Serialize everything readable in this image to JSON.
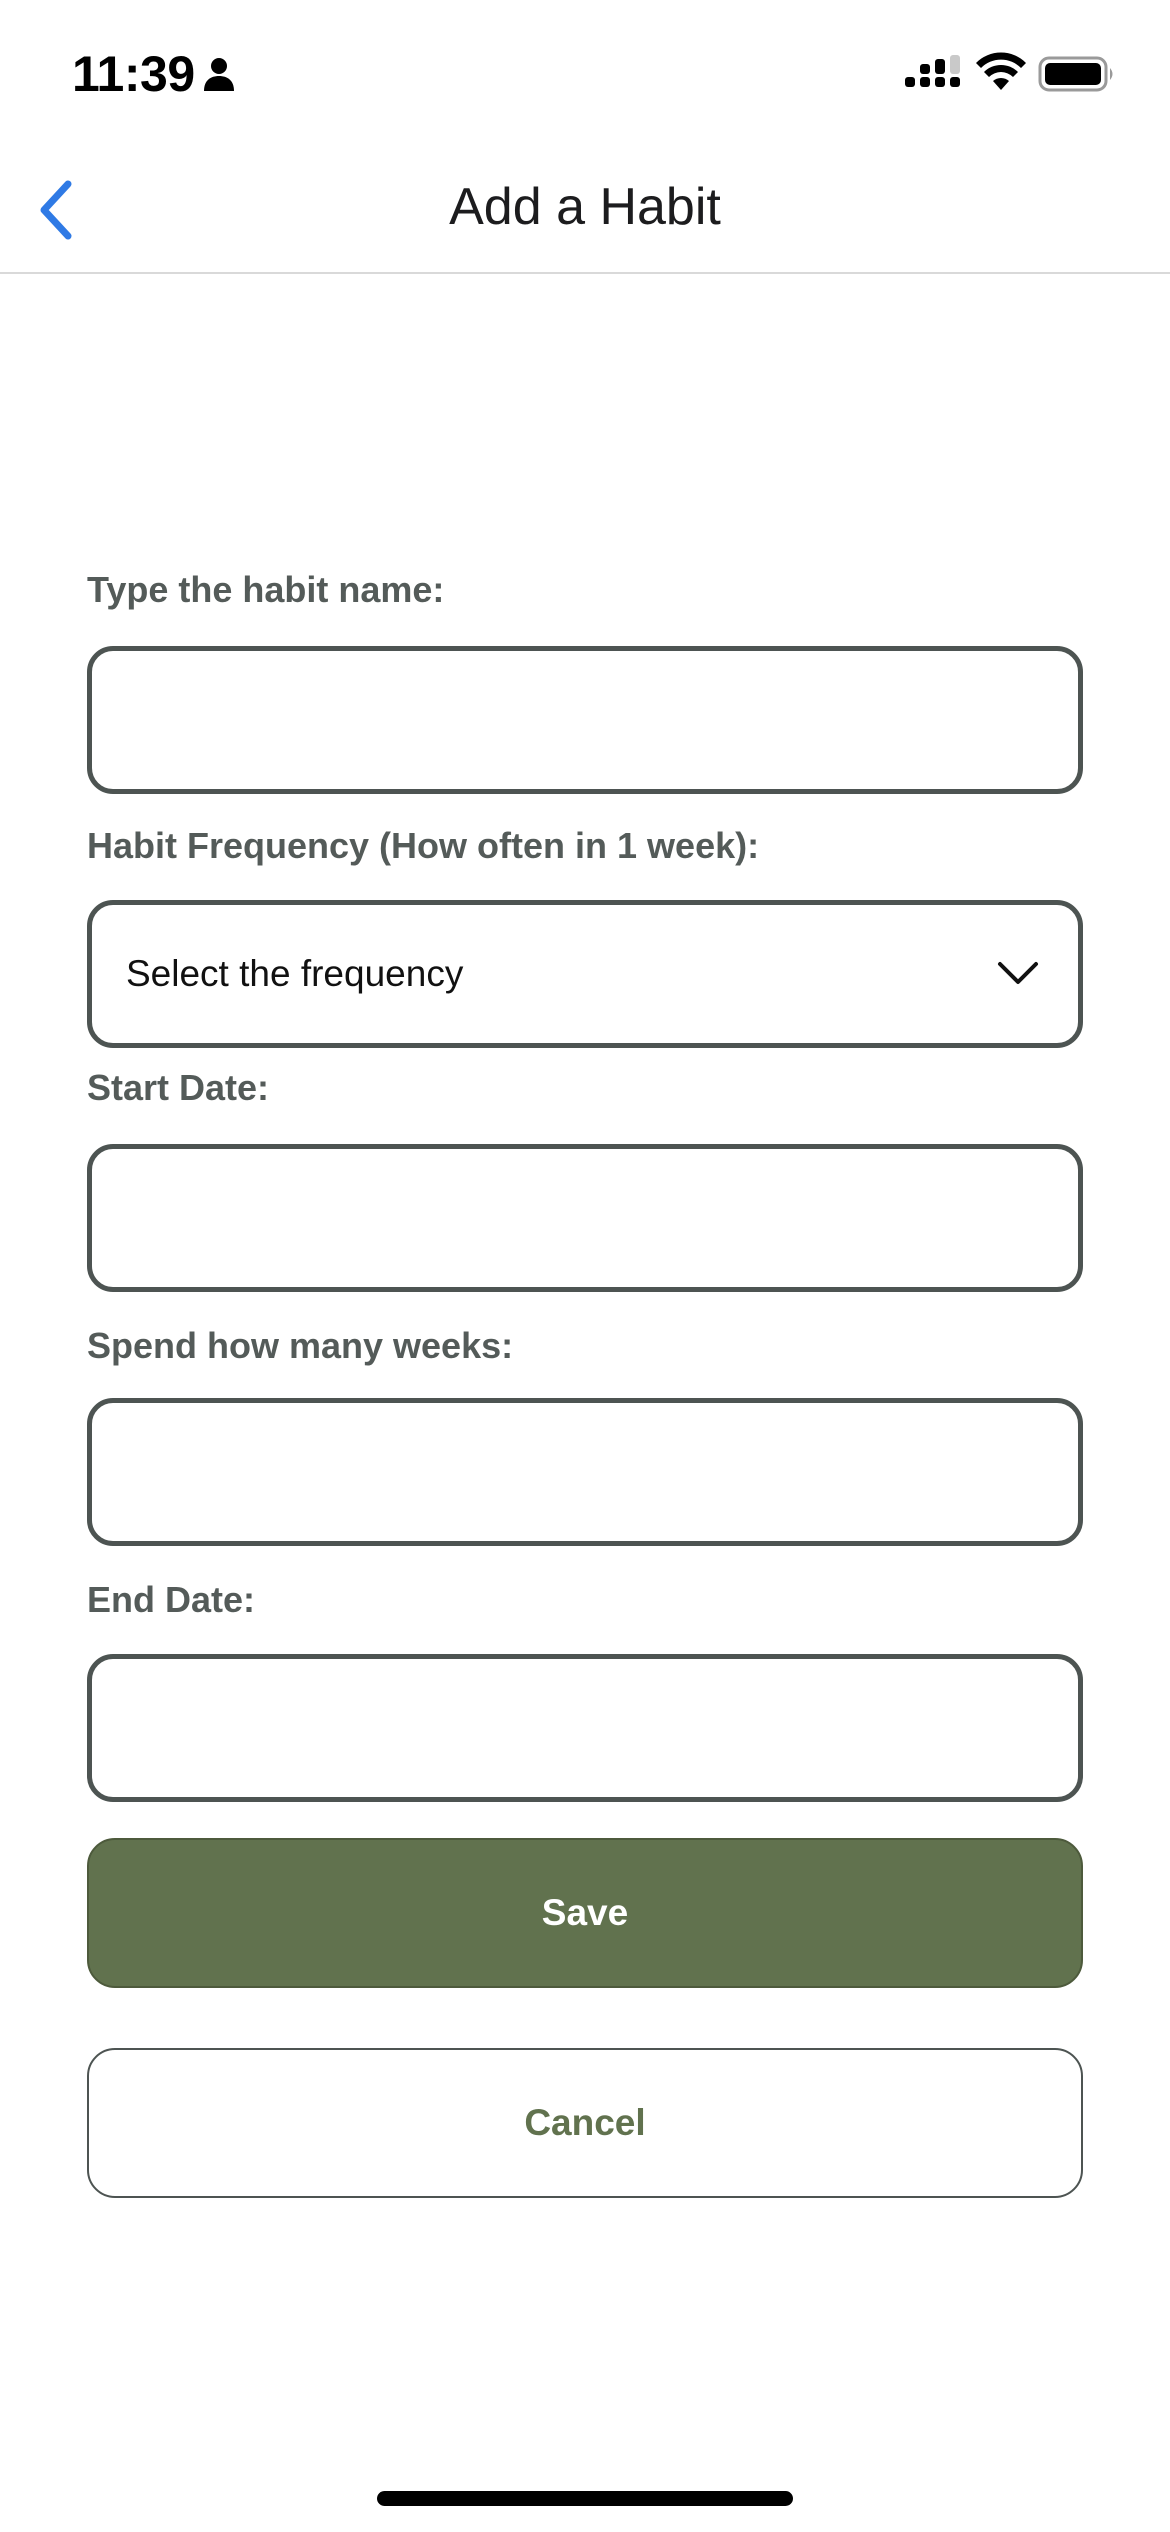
{
  "status_bar": {
    "time": "11:39",
    "icons": [
      "person-icon",
      "cellular-signal-icon",
      "wifi-icon",
      "battery-icon"
    ]
  },
  "header": {
    "title": "Add a Habit",
    "back_icon": "chevron-left-icon"
  },
  "form": {
    "habit_name_label": "Type the habit name:",
    "habit_name_value": "",
    "frequency_label": "Habit Frequency (How often in 1 week):",
    "frequency_value": "Select the frequency",
    "start_date_label": "Start Date:",
    "start_date_value": "",
    "weeks_label": "Spend how many weeks:",
    "weeks_value": "",
    "end_date_label": "End Date:",
    "end_date_value": ""
  },
  "actions": {
    "save_label": "Save",
    "cancel_label": "Cancel"
  },
  "colors": {
    "accent_blue": "#2f7ae5",
    "primary_green": "#61724e",
    "label_gray": "#545b59",
    "field_border": "#4d5452"
  }
}
